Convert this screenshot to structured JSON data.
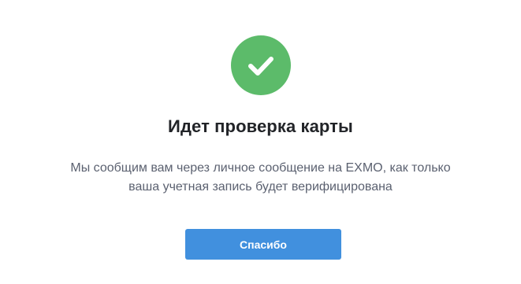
{
  "dialog": {
    "icon": "checkmark-icon",
    "icon_color": "#5cbb6a",
    "title": "Идет проверка карты",
    "message_line_1": "Мы сообщим вам через личное сообщение на EXMO, как только",
    "message_line_2": "ваша учетная запись будет верифицирована",
    "button_label": "Спасибо",
    "button_color": "#4190de"
  }
}
